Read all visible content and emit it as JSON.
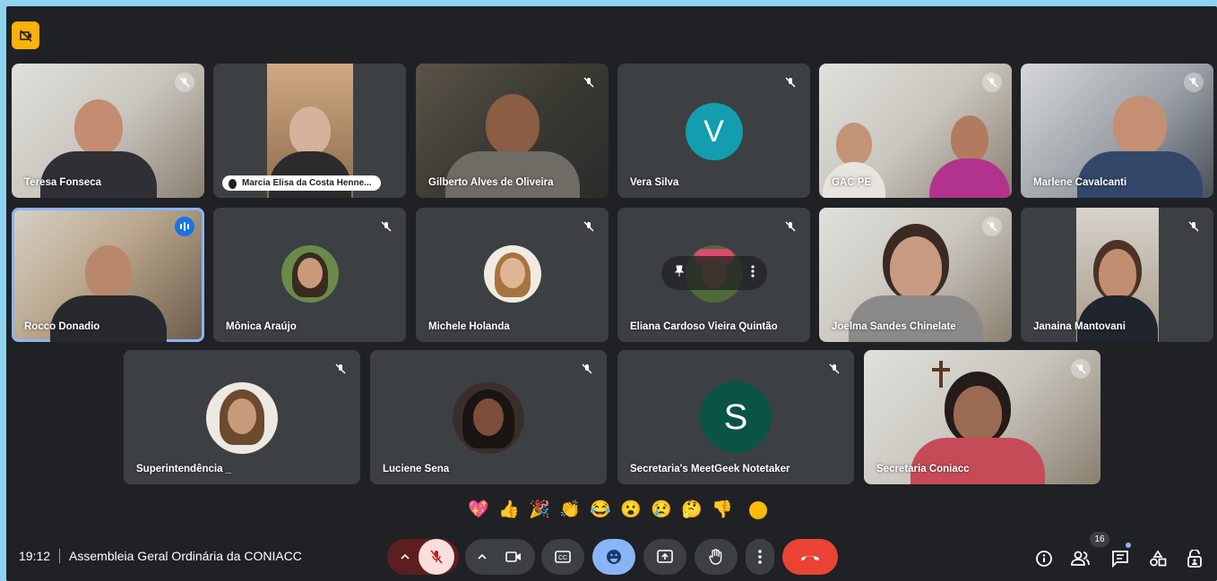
{
  "meeting": {
    "time": "19:12",
    "title": "Assembleia Geral Ordinária da CONIACC",
    "participant_count": "16"
  },
  "tiles": [
    {
      "name": "Teresa Fonseca"
    },
    {
      "name": "Marcia Elisa da Costa Henne..."
    },
    {
      "name": "Gilberto Alves de Oliveira"
    },
    {
      "name": "Vera Silva",
      "avatar_letter": "V"
    },
    {
      "name": "GAC PE"
    },
    {
      "name": "Marlene Cavalcanti"
    },
    {
      "name": "Rocco Donadio"
    },
    {
      "name": "Mônica Araújo"
    },
    {
      "name": "Michele Holanda"
    },
    {
      "name": "Eliana Cardoso Vieira Quintão"
    },
    {
      "name": "Joelma Sandes Chinelate"
    },
    {
      "name": "Janaina Mantovani"
    },
    {
      "name": "Superintendência _"
    },
    {
      "name": "Luciene Sena"
    },
    {
      "name": "Secretaria's MeetGeek Notetaker",
      "avatar_letter": "S"
    },
    {
      "name": "Secretaria Coniacc"
    }
  ],
  "reactions": [
    "💖",
    "👍",
    "🎉",
    "👏",
    "😂",
    "😮",
    "😢",
    "🤔",
    "👎"
  ],
  "colors": {
    "background": "#202124",
    "tile": "#3c4043",
    "accent_blue": "#8ab4f8",
    "end_call_red": "#ea4335",
    "avatar_v": "#129eaf",
    "avatar_s": "#0b5345",
    "warning_yellow": "#f9b208"
  }
}
